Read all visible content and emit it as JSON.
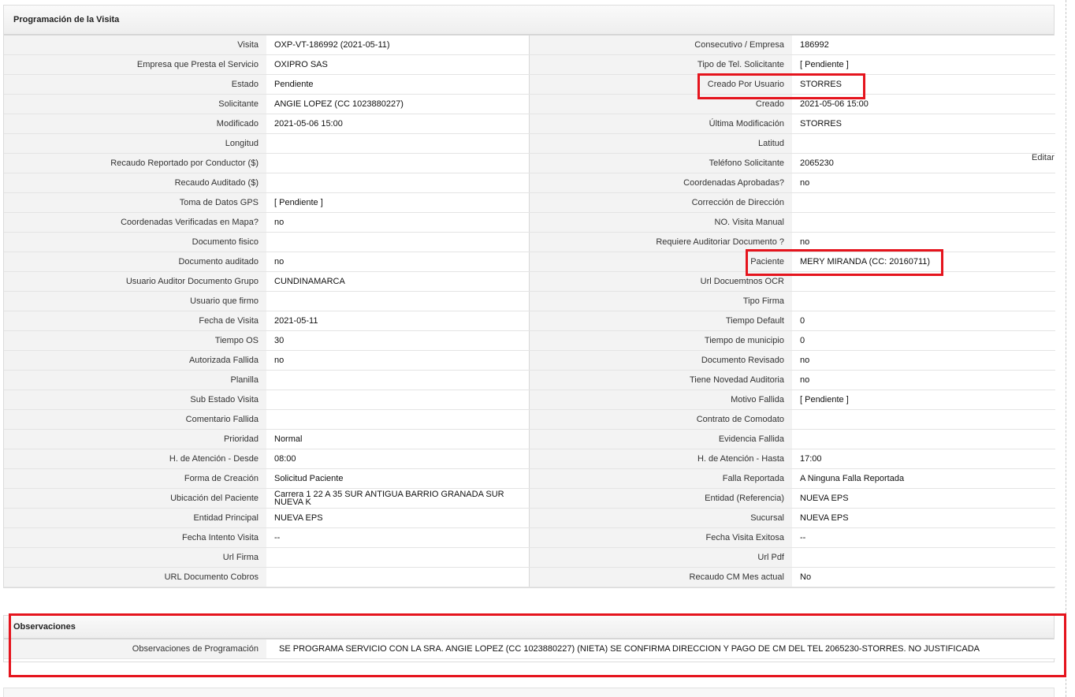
{
  "section": {
    "title": "Programación de la Visita"
  },
  "edit_label": "Editar",
  "rows": [
    {
      "l1": "Visita",
      "v1": "OXP-VT-186992 (2021-05-11)",
      "l2": "Consecutivo / Empresa",
      "v2": "186992"
    },
    {
      "l1": "Empresa que Presta el Servicio",
      "v1": "OXIPRO SAS",
      "l2": "Tipo de Tel. Solicitante",
      "v2": "[ Pendiente ]"
    },
    {
      "l1": "Estado",
      "v1": "Pendiente",
      "l2": "Creado Por Usuario",
      "v2": "STORRES"
    },
    {
      "l1": "Solicitante",
      "v1": "ANGIE LOPEZ (CC 1023880227)",
      "l2": "Creado",
      "v2": "2021-05-06 15:00"
    },
    {
      "l1": "Modificado",
      "v1": "2021-05-06 15:00",
      "l2": "Última Modificación",
      "v2": " STORRES"
    },
    {
      "l1": "Longitud",
      "v1": "",
      "l2": "Latitud",
      "v2": ""
    },
    {
      "l1": "Recaudo Reportado por Conductor ($)",
      "v1": "",
      "l2": "Teléfono Solicitante",
      "v2": "2065230"
    },
    {
      "l1": "Recaudo Auditado ($)",
      "v1": "",
      "l2": "Coordenadas Aprobadas?",
      "v2": " no"
    },
    {
      "l1": "Toma de Datos GPS",
      "v1": "[ Pendiente ]",
      "l2": "Corrección de Dirección",
      "v2": ""
    },
    {
      "l1": "Coordenadas Verificadas en Mapa?",
      "v1": " no",
      "l2": "NO. Visita Manual",
      "v2": ""
    },
    {
      "l1": "Documento fisico",
      "v1": "",
      "l2": "Requiere Auditoriar Documento ?",
      "v2": " no"
    },
    {
      "l1": "Documento auditado",
      "v1": " no",
      "l2": "Paciente",
      "v2": "MERY MIRANDA (CC: 20160711)"
    },
    {
      "l1": "Usuario Auditor Documento Grupo",
      "v1": "CUNDINAMARCA",
      "l2": "Url Docuemtnos OCR",
      "v2": ""
    },
    {
      "l1": "Usuario que firmo",
      "v1": "",
      "l2": "Tipo Firma",
      "v2": ""
    },
    {
      "l1": "Fecha de Visita",
      "v1": " 2021-05-11",
      "l2": "Tiempo Default",
      "v2": "0"
    },
    {
      "l1": "Tiempo OS",
      "v1": "30",
      "l2": "Tiempo de municipio",
      "v2": "0"
    },
    {
      "l1": "Autorizada Fallida",
      "v1": " no",
      "l2": "Documento Revisado",
      "v2": " no"
    },
    {
      "l1": "Planilla",
      "v1": "",
      "l2": "Tiene Novedad Auditoria",
      "v2": " no"
    },
    {
      "l1": "Sub Estado Visita",
      "v1": "",
      "l2": "Motivo Fallida",
      "v2": "[ Pendiente ]"
    },
    {
      "l1": "Comentario Fallida",
      "v1": "",
      "l2": "Contrato de Comodato",
      "v2": ""
    },
    {
      "l1": "Prioridad",
      "v1": "Normal",
      "l2": "Evidencia Fallida",
      "v2": ""
    },
    {
      "l1": "H. de Atención - Desde",
      "v1": "08:00",
      "l2": "H. de Atención - Hasta",
      "v2": "17:00"
    },
    {
      "l1": "Forma de Creación",
      "v1": "Solicitud Paciente",
      "l2": "Falla Reportada",
      "v2": "A Ninguna Falla Reportada"
    },
    {
      "l1": "Ubicación del Paciente",
      "v1": "Carrera 1 22 A 35 SUR ANTIGUA BARRIO GRANADA SUR NUEVA K",
      "l2": "Entidad (Referencia)",
      "v2": "NUEVA EPS"
    },
    {
      "l1": "Entidad Principal",
      "v1": "NUEVA EPS",
      "l2": "Sucursal",
      "v2": "NUEVA EPS"
    },
    {
      "l1": "Fecha Intento Visita",
      "v1": " --",
      "l2": "Fecha Visita Exitosa",
      "v2": " --"
    },
    {
      "l1": "Url Firma",
      "v1": "",
      "l2": "Url Pdf",
      "v2": ""
    },
    {
      "l1": "URL Documento Cobros",
      "v1": "",
      "l2": "Recaudo CM Mes actual",
      "v2": "No"
    }
  ],
  "observations": {
    "title": "Observaciones",
    "label": "Observaciones de Programación",
    "value": "SE PROGRAMA SERVICIO CON LA SRA. ANGIE LOPEZ (CC 1023880227) (NIETA) SE CONFIRMA DIRECCION Y PAGO DE CM DEL TEL 2065230-STORRES. NO JUSTIFICADA"
  },
  "colors": {
    "highlight": "#e5141d",
    "label_bg": "#f3f3f3",
    "border": "#dcdcdc"
  }
}
